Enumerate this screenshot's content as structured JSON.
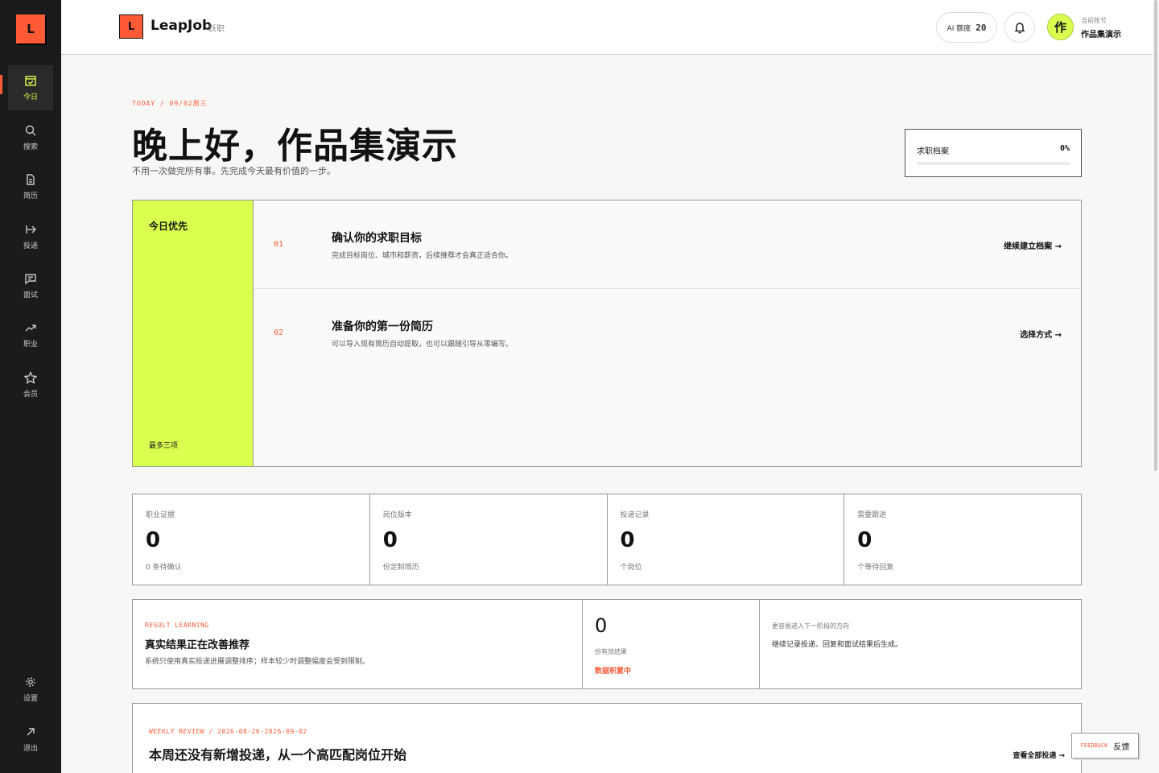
{
  "sidebar": {
    "logo": "L",
    "items": [
      {
        "label": "今日",
        "icon": "calendar-check-icon",
        "active": true
      },
      {
        "label": "搜索",
        "icon": "search-icon"
      },
      {
        "label": "简历",
        "icon": "document-icon"
      },
      {
        "label": "投递",
        "icon": "send-arrow-icon"
      },
      {
        "label": "面试",
        "icon": "chat-icon"
      },
      {
        "label": "职业",
        "icon": "trend-up-icon"
      },
      {
        "label": "会员",
        "icon": "star-icon"
      }
    ],
    "bottom_items": [
      {
        "label": "设置",
        "icon": "gear-icon"
      },
      {
        "label": "退出",
        "icon": "arrow-out-icon"
      }
    ]
  },
  "header": {
    "logo": "L",
    "brand": "LeapJob",
    "brand_sub": "跃职",
    "quota_label": "AI 额度",
    "quota_value": "20",
    "avatar_char": "作",
    "account_label": "当前账号",
    "account_name": "作品集演示"
  },
  "hero": {
    "crumb": "TODAY / 09/02周三",
    "greeting": "晚上好，作品集演示",
    "subtitle": "不用一次做完所有事。先完成今天最有价值的一步。",
    "profile_label": "求职档案",
    "profile_percent": "0%",
    "profile_progress": 0
  },
  "priority": {
    "title": "今日优先",
    "footer": "最多三项",
    "tasks": [
      {
        "no": "01",
        "title": "确认你的求职目标",
        "desc": "完成目标岗位、城市和薪资，后续推荐才会真正适合你。",
        "action": "继续建立档案 →"
      },
      {
        "no": "02",
        "title": "准备你的第一份简历",
        "desc": "可以导入现有简历自动提取，也可以跟随引导从零编写。",
        "action": "选择方式 →"
      }
    ]
  },
  "stats": [
    {
      "label": "职业证据",
      "value": "0",
      "sub": "0 条待确认"
    },
    {
      "label": "岗位版本",
      "value": "0",
      "sub": "份定制简历"
    },
    {
      "label": "投递记录",
      "value": "0",
      "sub": "个岗位"
    },
    {
      "label": "需要跟进",
      "value": "0",
      "sub": "个等待回复"
    }
  ],
  "result": {
    "tag": "RESULT LEARNING",
    "title": "真实结果正在改善推荐",
    "desc": "系统只使用真实投递进展调整排序；样本较少时调整幅度会受到限制。",
    "count": "0",
    "count_unit": "份有效结果",
    "status": "数据积累中",
    "next_label": "更容易进入下一阶段的方向",
    "next_desc": "继续记录投递、回复和面试结果后生成。"
  },
  "weekly": {
    "tag": "WEEKLY REVIEW / 2026-08-26-2026-09-02",
    "title": "本周还没有新增投递，从一个高匹配岗位开始",
    "action": "查看全部投递 →"
  },
  "feedback": {
    "en": "FEEDBACK",
    "cn": "反馈"
  },
  "colors": {
    "accent": "#ff5a36",
    "highlight": "#d9ff4f",
    "sidebar_bg": "#1b1b1b"
  }
}
